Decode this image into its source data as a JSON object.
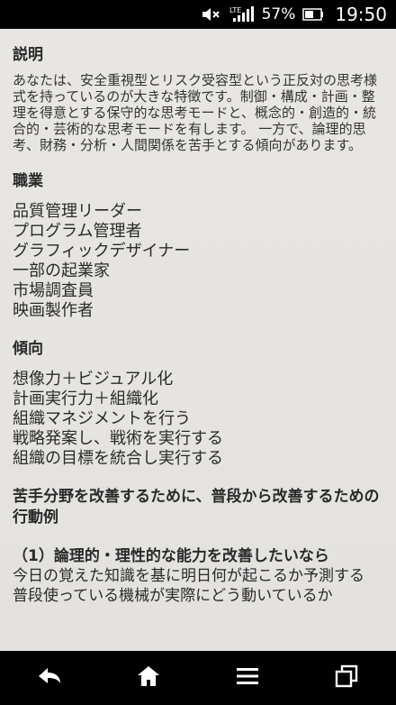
{
  "status_bar": {
    "network": "LTE",
    "battery_percent": "57%",
    "time": "19:50"
  },
  "sections": {
    "description": {
      "heading": "説明",
      "text": "あなたは、安全重視型とリスク受容型という正反対の思考様式を持っているのが大きな特徴です。制御・構成・計画・整理を得意とする保守的な思考モードと、概念的・創造的・統合的・芸術的な思考モードを有します。 一方で、論理的思考、財務・分析・人間関係を苦手とする傾向があります。"
    },
    "occupations": {
      "heading": "職業",
      "items": [
        "品質管理リーダー",
        "プログラム管理者",
        "グラフィックデザイナー",
        "一部の起業家",
        "市場調査員",
        "映画製作者"
      ]
    },
    "tendencies": {
      "heading": "傾向",
      "items": [
        "想像力＋ビジュアル化",
        "計画実行力＋組織化",
        "組織マネジメントを行う",
        "戦略発案し、戦術を実行する",
        "組織の目標を統合し実行する"
      ]
    },
    "improvement": {
      "heading": "苦手分野を改善するために、普段から改善するための行動例",
      "sub_heading": "（1）論理的・理性的な能力を改善したいなら",
      "lines": [
        "今日の覚えた知識を基に明日何が起こるか予測する",
        "普段使っている機械が実際にどう動いているか"
      ]
    }
  },
  "nav": {
    "back_icon": "back-arrow-icon",
    "home_icon": "home-icon",
    "menu_icon": "menu-icon",
    "recents_icon": "recent-apps-icon"
  }
}
